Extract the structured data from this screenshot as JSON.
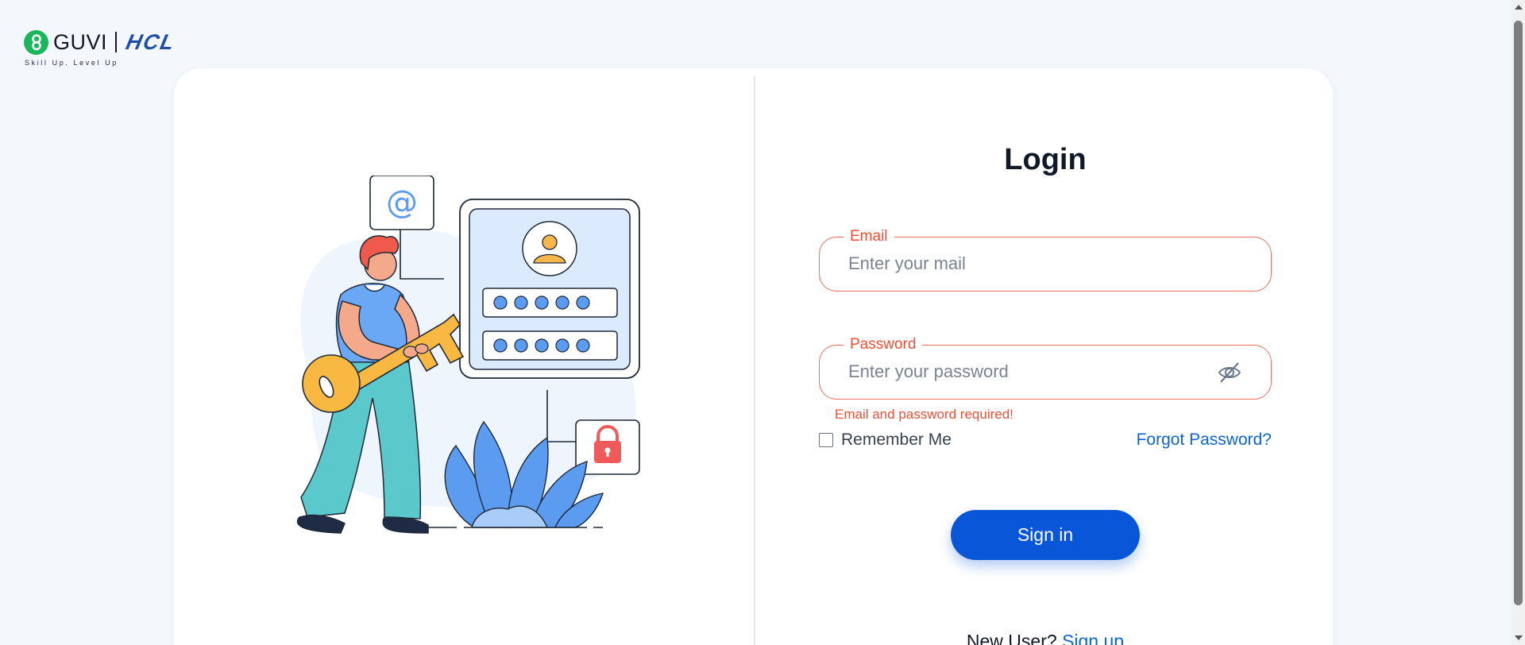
{
  "brand": {
    "guvi": "GUVI",
    "hcl": "HCL",
    "tagline": "Skill Up. Level Up"
  },
  "login": {
    "title": "Login",
    "email": {
      "label": "Email",
      "placeholder": "Enter your mail",
      "value": ""
    },
    "password": {
      "label": "Password",
      "placeholder": "Enter your password",
      "value": ""
    },
    "error": "Email and password required!",
    "remember_label": "Remember Me",
    "remember_checked": false,
    "forgot_label": "Forgot Password?",
    "signin_label": "Sign in",
    "new_user_text": "New User?",
    "signup_label": "Sign up"
  },
  "colors": {
    "primary": "#0957d8",
    "error": "#ef4e36",
    "link": "#0b64d8",
    "brand_green": "#1bb55c",
    "hcl_blue": "#1d4fa8"
  },
  "icons": {
    "brand": "guvi-logo-icon",
    "password_toggle": "eye-off-icon",
    "illustration": [
      "at-sign-icon",
      "user-avatar-icon",
      "lock-icon",
      "key-icon"
    ]
  }
}
